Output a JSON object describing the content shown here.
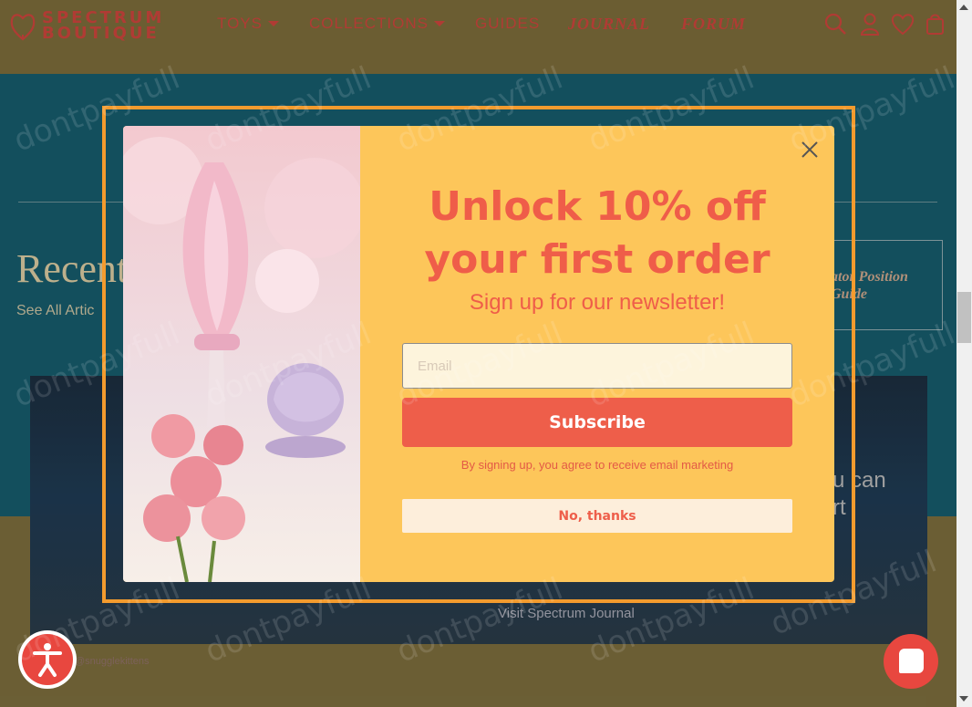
{
  "brand": {
    "logo_text_line1": "SPECTRUM",
    "logo_text_line2": "BOUTIQUE"
  },
  "nav": {
    "items": [
      {
        "label": "TOYS"
      },
      {
        "label": "COLLECTIONS"
      },
      {
        "label": "GUIDES"
      },
      {
        "label": "JOURNAL"
      },
      {
        "label": "FORUM"
      }
    ]
  },
  "header_icons": [
    "search-icon",
    "account-icon",
    "wishlist-heart-icon",
    "cart-bag-icon"
  ],
  "background": {
    "section_title": "Recent",
    "see_all_label": "See All Artic",
    "card_title": "ator Position Guide",
    "banner_side_text_1": "u can",
    "banner_side_text_2": "rt",
    "visit_label": "Visit Spectrum Journal",
    "instagram_handle": "@snugglekittens"
  },
  "popup": {
    "headline": "Unlock 10% off your first order",
    "subheadline": "Sign up for our newsletter!",
    "email_placeholder": "Email",
    "email_value": "",
    "subscribe_label": "Subscribe",
    "disclaimer": "By signing up, you agree to receive email marketing",
    "decline_label": "No, thanks"
  },
  "watermark": "dontpayfull",
  "colors": {
    "brand_red": "#c9443c",
    "popup_bg": "#fdc65a",
    "popup_accent": "#ee5e4a",
    "frame_orange": "#f39b2e",
    "teal": "#165a6a"
  }
}
